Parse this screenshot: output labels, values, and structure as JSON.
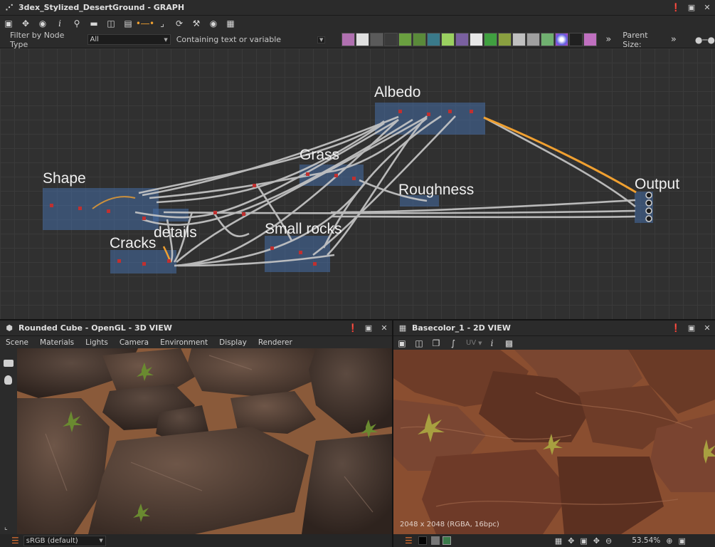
{
  "graph_panel": {
    "title": "3dex_Stylized_DesertGround - GRAPH",
    "filter_label": "Filter by Node Type",
    "filter_value": "All",
    "search_placeholder": "Containing text or variable",
    "parent_size_label": "Parent Size:",
    "more_glyph": "»",
    "frames": {
      "albedo": "Albedo",
      "grass": "Grass",
      "shape": "Shape",
      "roughness": "Roughness",
      "output": "Output",
      "details": "details",
      "cracks": "Cracks",
      "small_rocks": "Small rocks"
    }
  },
  "view3d_panel": {
    "title": "Rounded Cube - OpenGL - 3D VIEW",
    "menu": [
      "Scene",
      "Materials",
      "Lights",
      "Camera",
      "Environment",
      "Display",
      "Renderer"
    ],
    "colorspace": "sRGB (default)"
  },
  "view2d_panel": {
    "title": "Basecolor_1 - 2D VIEW",
    "uv_label": "UV",
    "resolution_info": "2048 x 2048 (RGBA, 16bpc)",
    "zoom": "53.54%"
  },
  "colors": {
    "accent_orange": "#f0a030",
    "frame_blue": "#466ea5",
    "wire_gray": "#c8c8c8"
  }
}
